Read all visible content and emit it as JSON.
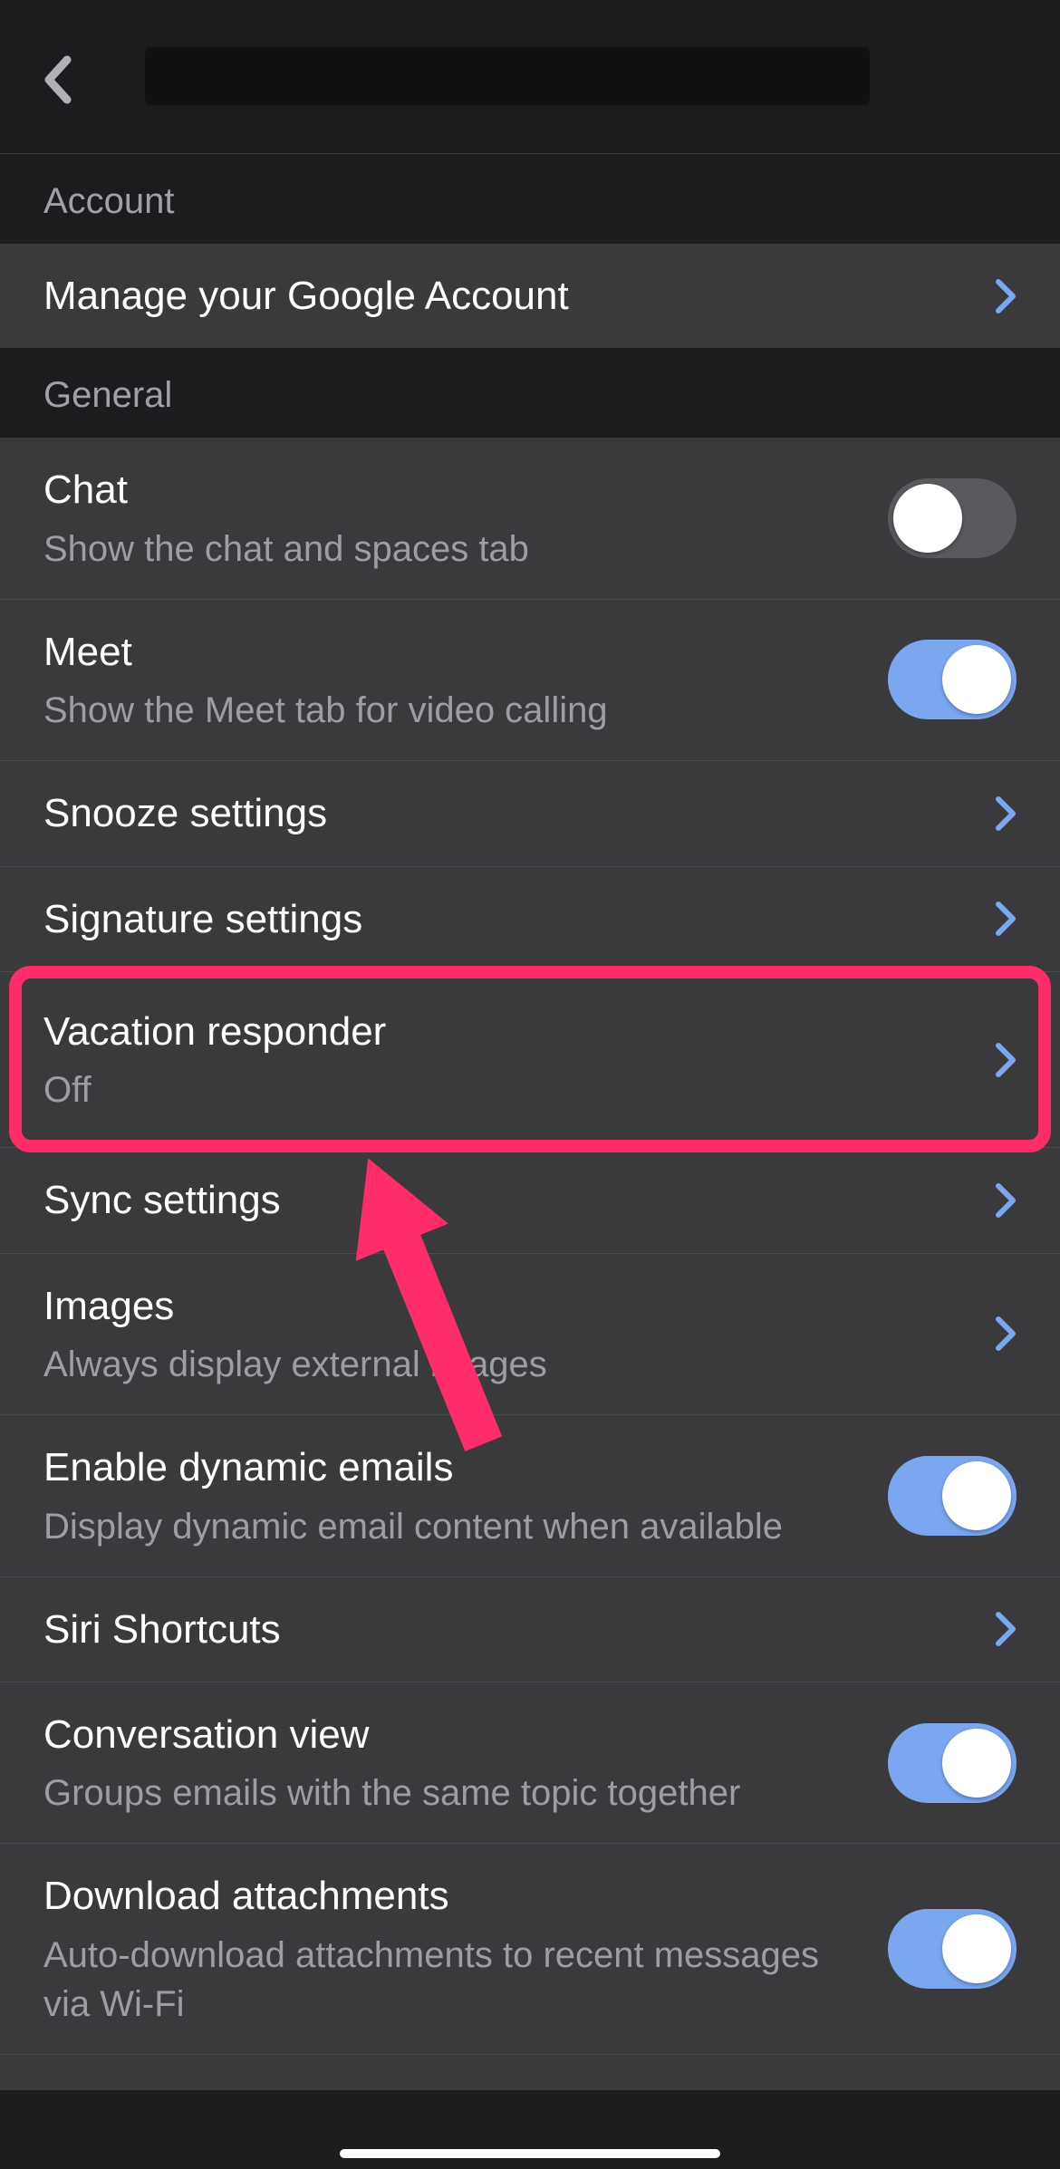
{
  "sections": {
    "account": {
      "header": "Account",
      "manage": {
        "title": "Manage your Google Account"
      }
    },
    "general": {
      "header": "General",
      "chat": {
        "title": "Chat",
        "sub": "Show the chat and spaces tab",
        "on": false
      },
      "meet": {
        "title": "Meet",
        "sub": "Show the Meet tab for video calling",
        "on": true
      },
      "snooze": {
        "title": "Snooze settings"
      },
      "signature": {
        "title": "Signature settings"
      },
      "vacation": {
        "title": "Vacation responder",
        "sub": "Off"
      },
      "sync": {
        "title": "Sync settings"
      },
      "images": {
        "title": "Images",
        "sub": "Always display external images"
      },
      "dynamic": {
        "title": "Enable dynamic emails",
        "sub": "Display dynamic email content when available",
        "on": true
      },
      "siri": {
        "title": "Siri Shortcuts"
      },
      "conversation": {
        "title": "Conversation view",
        "sub": "Groups emails with the same topic together",
        "on": true
      },
      "download": {
        "title": "Download attachments",
        "sub": "Auto-download attachments to recent messages via Wi-Fi",
        "on": true
      }
    }
  },
  "annotation": {
    "highlight_target": "vacation-responder-row",
    "arrow_color": "#ff2d6a"
  }
}
